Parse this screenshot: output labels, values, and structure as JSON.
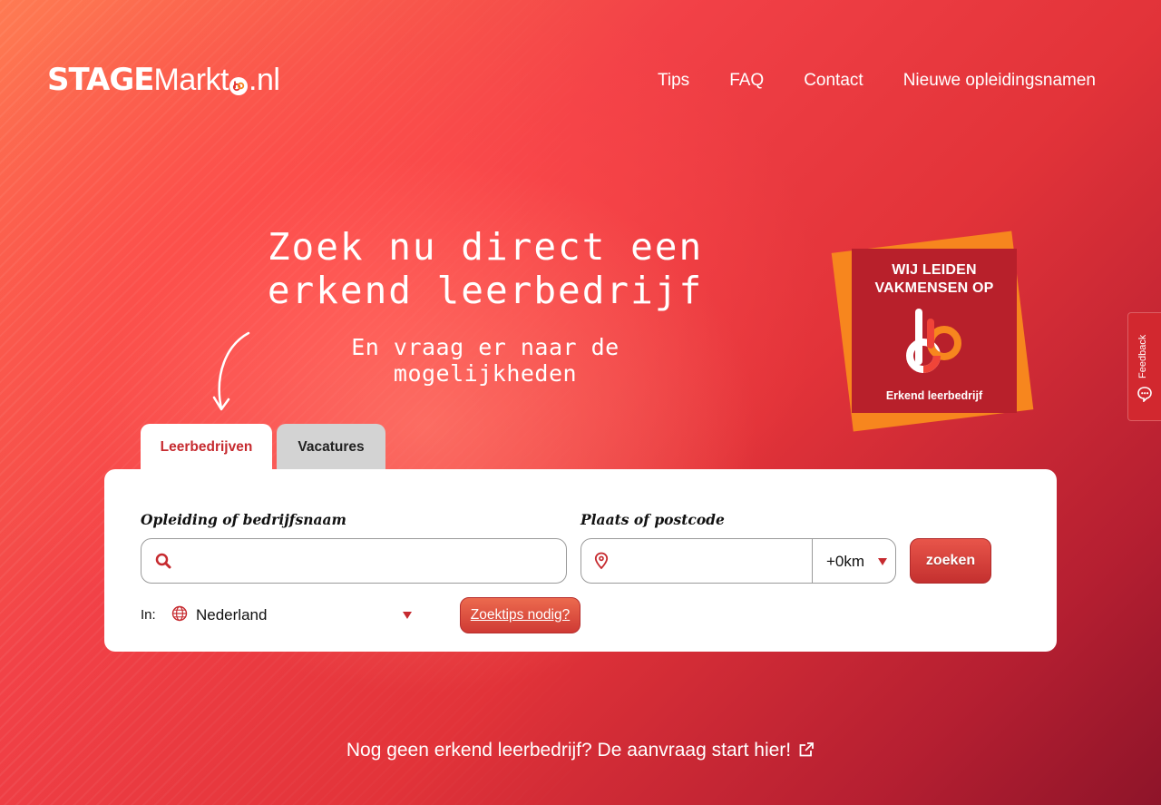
{
  "logo": {
    "bold": "STAGE",
    "regular": "Markt",
    "suffix": ".nl"
  },
  "nav": {
    "items": [
      "Tips",
      "FAQ",
      "Contact",
      "Nieuwe opleidingsnamen"
    ]
  },
  "hero": {
    "headline_line1": "Zoek nu direct een",
    "headline_line2": "erkend leerbedrijf",
    "subline": "En vraag er naar de mogelijkheden"
  },
  "badge": {
    "line1": "WIJ LEIDEN",
    "line2": "VAKMENSEN OP",
    "bottom": "Erkend leerbedrijf"
  },
  "feedback": {
    "label": "Feedback"
  },
  "tabs": [
    {
      "label": "Leerbedrijven"
    },
    {
      "label": "Vacatures"
    }
  ],
  "search": {
    "label_left": "Opleiding of bedrijfsnaam",
    "label_right": "Plaats of postcode",
    "query_value": "",
    "place_value": "",
    "distance": "+0km",
    "submit": "zoeken",
    "in_label": "In:",
    "country": "Nederland",
    "tips_button": "Zoektips nodig?"
  },
  "footer_link": {
    "text": "Nog geen erkend leerbedrijf? De aanvraag start hier!"
  },
  "colors": {
    "brand_red": "#c62a2f",
    "badge_orange": "#f7861e",
    "badge_red": "#b8202b"
  },
  "icons": [
    "search-icon",
    "location-pin-icon",
    "globe-icon",
    "chevron-down-icon",
    "external-link-icon",
    "feedback-icon",
    "arrow-icon"
  ]
}
